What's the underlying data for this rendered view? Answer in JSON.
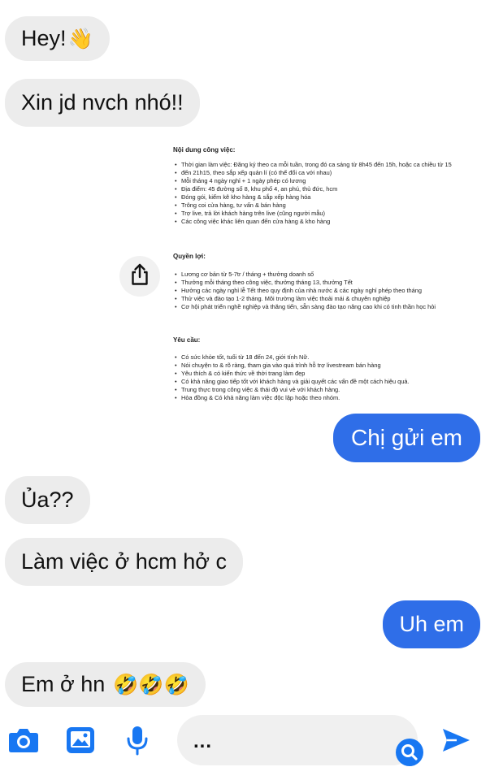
{
  "messages": {
    "m1": "Hey!",
    "m1_emoji": "👋",
    "m2": "Xin jd nvch nhó!!",
    "m3": "Chị gửi em",
    "m4": "Ủa??",
    "m5": "Làm việc ở hcm hở c",
    "m6": "Uh em",
    "m7": "Em ở hn",
    "m7_emoji": "🤣🤣🤣"
  },
  "jd": {
    "section1_title": "Nội dung công việc:",
    "section1_items": [
      "Thời gian làm việc: Đăng ký theo ca mỗi tuần, trong đó ca sáng từ 8h45 đến 15h, hoặc ca chiều từ 15",
      "đến 21h15, theo sắp xếp quản lí (có thể đổi ca với nhau)",
      "Mỗi tháng 4 ngày nghỉ + 1 ngày phép có lương",
      "Địa điểm: 45 đường số 8, khu phố 4, an phú, thủ đức, hcm",
      "Đóng gói, kiểm kê kho hàng & sắp xếp hàng hóa",
      "Trông coi cửa hàng, tư vấn & bán hàng",
      "Trợ live, trả lời khách hàng trên live (cũng người mẫu)",
      "Các công việc khác liên quan đến cửa hàng & kho hàng"
    ],
    "section2_title": "Quyền lợi:",
    "section2_items": [
      "Lương cơ bản từ 5-7tr / tháng + thưởng doanh số",
      "Thưởng mỗi tháng theo công việc, thưởng tháng 13, thưởng Tết",
      "Hưởng các ngày nghỉ lễ Tết theo quy định của nhà nước & các ngày nghỉ phép theo tháng",
      "Thử việc và đào tạo 1-2 tháng. Môi trường làm việc thoải mái & chuyên nghiệp",
      "Cơ hội phát triển nghề nghiệp và thăng tiến, sẵn sàng đào tạo nâng cao khi có tinh thần học hỏi"
    ],
    "section3_title": "Yêu cầu:",
    "section3_items": [
      "Có sức khỏe tốt, tuổi từ 18 đến 24, giới tính Nữ.",
      "Nói chuyện to & rõ ràng, tham gia vào quá trình hỗ trợ livestream bán hàng",
      "Yêu thích & có kiến thức về thời trang làm đẹp",
      "Có khả năng giao tiếp tốt với khách hàng và giải quyết các vấn đề một cách hiệu quả.",
      "Trung thực trong công việc & thái độ vui vẻ với khách hàng.",
      "Hòa đồng & Có khả năng làm việc độc lập hoặc theo nhóm."
    ]
  },
  "composer": {
    "placeholder": "..."
  },
  "colors": {
    "accent": "#2f6ee8",
    "incoming_bubble": "#ececec",
    "icon_blue": "#1877f2"
  },
  "icons": [
    "share-icon",
    "camera-icon",
    "gallery-icon",
    "microphone-icon",
    "search-icon",
    "send-icon"
  ]
}
